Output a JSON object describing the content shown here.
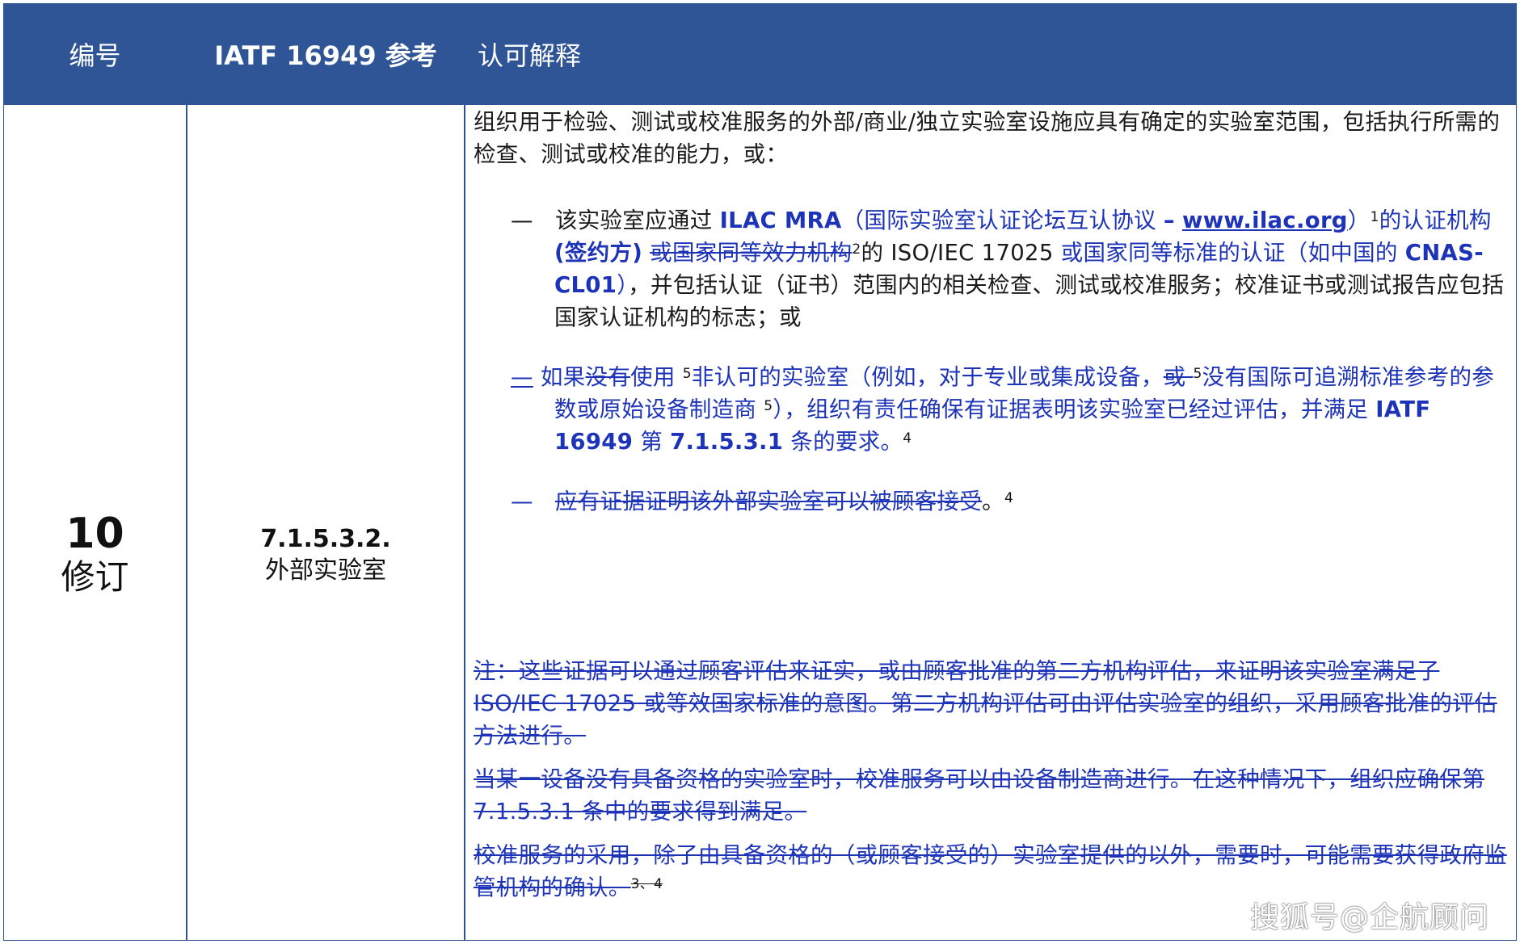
{
  "header": {
    "col1": "编号",
    "col2": "IATF 16949 参考",
    "col3": "认可解释"
  },
  "row": {
    "number": "10",
    "revision": "修订",
    "clause": "7.1.5.3.2.",
    "clause_name": "外部实验室",
    "intro": "组织用于检验、测试或校准服务的外部/商业/独立实验室设施应具有确定的实验室范围，包括执行所需的检查、测试或校准的能力，或：",
    "bullet1": {
      "dash": "—",
      "t1": "该实验室应通过 ",
      "t2": "ILAC MRA",
      "t3": "（国际实验室认证论坛互认协议 ",
      "t4": "–",
      "t5": " ",
      "t6": "www.ilac.org",
      "t7": "）",
      "sup1": "1",
      "t8": "的认证机构",
      "t9": "(签约方)",
      "t10": " ",
      "t11": "或国家同等效力机构",
      "sup2": "2",
      "t12": "的 ISO/IEC 17025 ",
      "t13": "或国家同等标准的认证（如中国的 ",
      "t14": "CNAS-CL01",
      "t15": "）",
      "t16": "，并包括认证（证书）范围内的相关检查、测试或校准服务；校准证书或测试报告应包括国家认证机构的标志；或"
    },
    "bullet2": {
      "dash": "—",
      "t1": " 如果",
      "t2": "没有",
      "t3": "使用 ",
      "sup1": "5",
      "t4": "非认可的实验室（例如，对于专业或集成设备，",
      "t5": "或 ",
      "sup2": "5",
      "t6": "没有国际可追溯标准参考的参数或原始设备制造商 ",
      "sup3": "5",
      "t7": "），组织有责任确保有证据表明该实验室已经过评估，并满足 ",
      "t8": "IATF 16949",
      "t9": " 第 ",
      "t10": "7.1.5.3.1",
      "t11": " 条的要求。",
      "sup4": "4"
    },
    "bullet3": {
      "dash": "—",
      "t1": "应有证据证明该外部实验室可以被顾客接受",
      "t2": "。",
      "sup1": "4"
    },
    "note1": "注：这些证据可以通过顾客评估来证实，或由顾客批准的第二方机构评估，来证明该实验室满足了 ISO/IEC 17025 或等效国家标准的意图。第二方机构评估可由评估实验室的组织，采用顾客批准的评估方法进行。",
    "note2": "当某一设备没有具备资格的实验室时，校准服务可以由设备制造商进行。在这种情况下，组织应确保第 7.1.5.3.1 条中的要求得到满足。",
    "note3": "校准服务的采用，除了由具备资格的（或顾客接受的）实验室提供的以外，需要时，可能需要获得政府监管机构的确认。",
    "note3_sup": "3、4"
  },
  "watermark": "搜狐号@企航顾问",
  "colors": {
    "header_bg": "#2f5597",
    "border": "#2f5496",
    "revision_blue": "#1d33b8"
  }
}
